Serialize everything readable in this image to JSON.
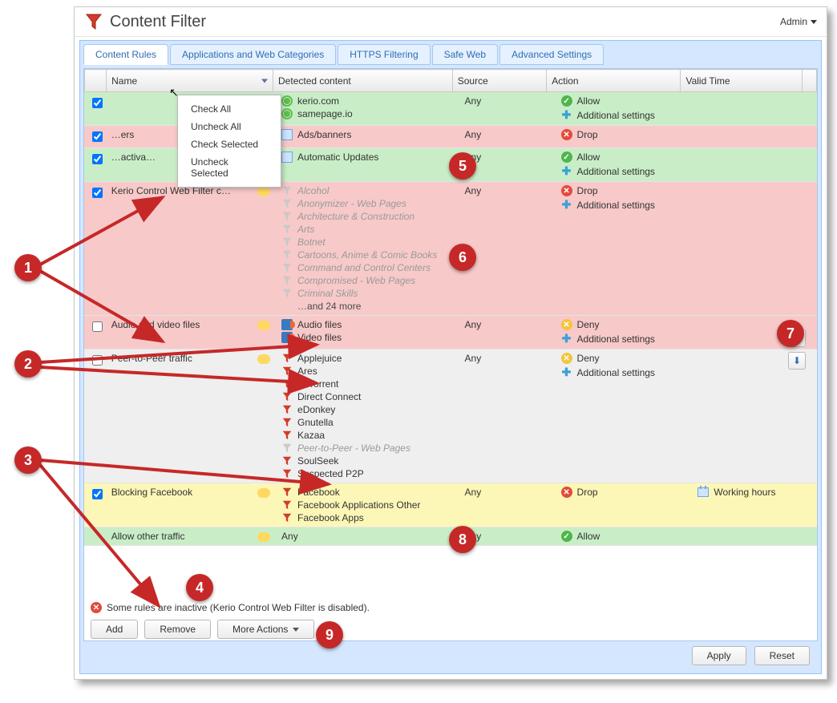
{
  "header": {
    "title": "Content Filter",
    "admin_label": "Admin"
  },
  "tabs": [
    "Content Rules",
    "Applications and Web Categories",
    "HTTPS Filtering",
    "Safe Web",
    "Advanced Settings"
  ],
  "columns": {
    "check": "",
    "name": "Name",
    "detected": "Detected content",
    "source": "Source",
    "action": "Action",
    "valid": "Valid Time"
  },
  "context_menu": [
    "Check All",
    "Uncheck All",
    "Check Selected",
    "Uncheck Selected"
  ],
  "rows": [
    {
      "checked": true,
      "name": "",
      "color": "green",
      "detected": [
        {
          "icon": "globe",
          "label": "kerio.com"
        },
        {
          "icon": "globe",
          "label": "samepage.io"
        }
      ],
      "source": "Any",
      "action": {
        "type": "allow",
        "label": "Allow",
        "additional": true
      },
      "valid": ""
    },
    {
      "checked": true,
      "name": "…ers",
      "color": "pink",
      "detected": [
        {
          "icon": "ad",
          "label": "Ads/banners"
        }
      ],
      "source": "Any",
      "action": {
        "type": "drop",
        "label": "Drop",
        "additional": false
      },
      "valid": ""
    },
    {
      "checked": true,
      "name": "…activa…",
      "color": "green",
      "detected": [
        {
          "icon": "ad",
          "label": "Automatic Updates"
        }
      ],
      "source": "Any",
      "action": {
        "type": "allow",
        "label": "Allow",
        "additional": true
      },
      "valid": ""
    },
    {
      "checked": true,
      "name": "Kerio Control Web Filter categor…",
      "color": "pink",
      "detected": [
        {
          "icon": "funnel-dim",
          "label": "Alcohol",
          "dim": true
        },
        {
          "icon": "funnel-dim",
          "label": "Anonymizer - Web Pages",
          "dim": true
        },
        {
          "icon": "funnel-dim",
          "label": "Architecture & Construction",
          "dim": true
        },
        {
          "icon": "funnel-dim",
          "label": "Arts",
          "dim": true
        },
        {
          "icon": "funnel-dim",
          "label": "Botnet",
          "dim": true
        },
        {
          "icon": "funnel-dim",
          "label": "Cartoons, Anime & Comic Books",
          "dim": true
        },
        {
          "icon": "funnel-dim",
          "label": "Command and Control Centers",
          "dim": true
        },
        {
          "icon": "funnel-dim",
          "label": "Compromised - Web Pages",
          "dim": true
        },
        {
          "icon": "funnel-dim",
          "label": "Criminal Skills",
          "dim": true
        },
        {
          "icon": "more",
          "label": "…and 24 more"
        }
      ],
      "source": "Any",
      "action": {
        "type": "drop",
        "label": "Drop",
        "additional": true
      },
      "valid": ""
    },
    {
      "checked": false,
      "name": "Audio and video files",
      "color": "pink",
      "detected": [
        {
          "icon": "audio",
          "label": "Audio files"
        },
        {
          "icon": "audio",
          "label": "Video files"
        }
      ],
      "source": "Any",
      "action": {
        "type": "deny",
        "label": "Deny",
        "additional": true
      },
      "valid": ""
    },
    {
      "checked": false,
      "name": "Peer-to-Peer traffic",
      "color": "grey",
      "detected": [
        {
          "icon": "funnel",
          "label": "Applejuice"
        },
        {
          "icon": "funnel",
          "label": "Ares"
        },
        {
          "icon": "funnel",
          "label": "BitTorrent"
        },
        {
          "icon": "funnel",
          "label": "Direct Connect"
        },
        {
          "icon": "funnel",
          "label": "eDonkey"
        },
        {
          "icon": "funnel",
          "label": "Gnutella"
        },
        {
          "icon": "funnel",
          "label": "Kazaa"
        },
        {
          "icon": "funnel-dim",
          "label": "Peer-to-Peer - Web Pages",
          "dim": true
        },
        {
          "icon": "funnel",
          "label": "SoulSeek"
        },
        {
          "icon": "funnel",
          "label": "Suspected P2P"
        }
      ],
      "source": "Any",
      "action": {
        "type": "deny",
        "label": "Deny",
        "additional": true
      },
      "valid": ""
    },
    {
      "checked": true,
      "name": "Blocking Facebook",
      "color": "yellow",
      "detected": [
        {
          "icon": "funnel",
          "label": "Facebook"
        },
        {
          "icon": "funnel",
          "label": "Facebook Applications Other"
        },
        {
          "icon": "funnel",
          "label": "Facebook Apps"
        }
      ],
      "source": "Any",
      "action": {
        "type": "drop",
        "label": "Drop",
        "additional": false
      },
      "valid": "Working hours"
    },
    {
      "checked": null,
      "name": "Allow other traffic",
      "color": "greenlast",
      "detected": [
        {
          "icon": "none",
          "label": "Any"
        }
      ],
      "source": "Any",
      "action": {
        "type": "allow",
        "label": "Allow",
        "additional": false
      },
      "valid": ""
    }
  ],
  "warning": "Some rules are inactive (Kerio Control Web Filter is disabled).",
  "buttons": {
    "add": "Add",
    "remove": "Remove",
    "more": "More Actions"
  },
  "footer": {
    "apply": "Apply",
    "reset": "Reset"
  },
  "common": {
    "additional_settings": "Additional settings"
  },
  "annotations": [
    "1",
    "2",
    "3",
    "4",
    "5",
    "6",
    "7",
    "8",
    "9"
  ]
}
